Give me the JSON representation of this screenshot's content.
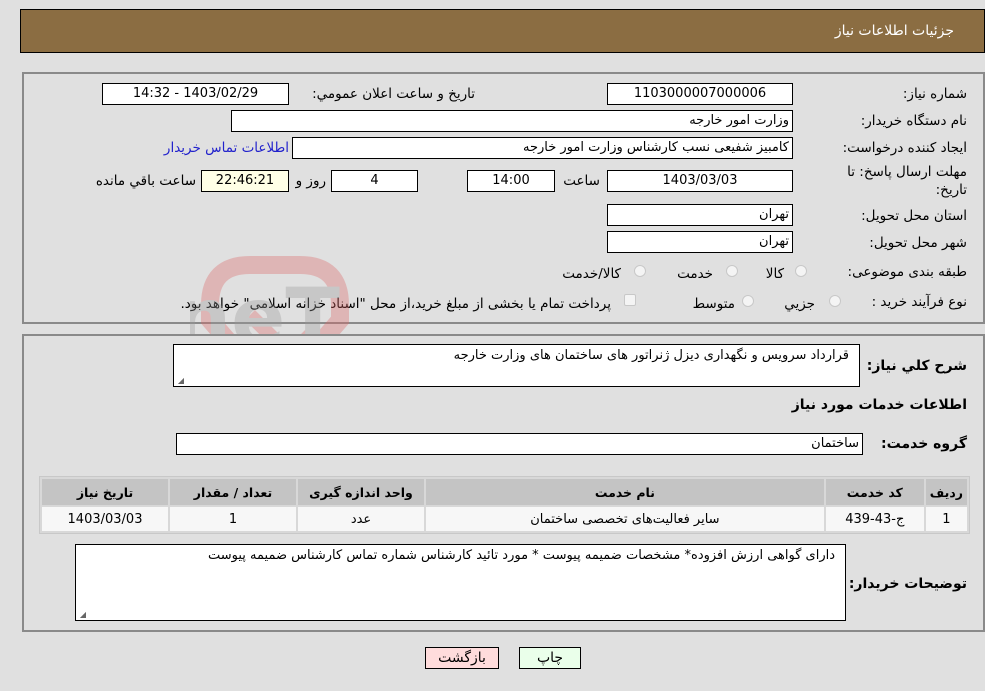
{
  "header": {
    "title": "جزئیات اطلاعات نیاز"
  },
  "form": {
    "need_number_label": "شماره نیاز:",
    "need_number": "1103000007000006",
    "announce_label": "تاریخ و ساعت اعلان عمومي:",
    "announce_value": "1403/02/29 - 14:32",
    "buyer_org_label": "نام دستگاه خریدار:",
    "buyer_org": "وزارت امور خارجه",
    "creator_label": "ایجاد کننده درخواست:",
    "creator": "کامبیز شفیعی نسب کارشناس وزارت امور خارجه",
    "buyer_contact_link": "اطلاعات تماس خریدار",
    "deadline_label_line1": "مهلت ارسال پاسخ: تا",
    "deadline_label_line2": "تاریخ:",
    "deadline_date": "1403/03/03",
    "time_label": "ساعت",
    "deadline_time": "14:00",
    "days_value": "4",
    "days_label": "روز و",
    "remaining_time": "22:46:21",
    "remaining_label": "ساعت باقي مانده",
    "province_label": "استان محل تحویل:",
    "province": "تهران",
    "city_label": "شهر محل تحویل:",
    "city": "تهران",
    "category_label": "طبقه بندی موضوعی:",
    "category_options": [
      "کالا",
      "خدمت",
      "کالا/خدمت"
    ],
    "process_label": "نوع فرآیند خرید :",
    "process_options": [
      "جزيي",
      "متوسط"
    ],
    "treasury_note": "پرداخت تمام یا بخشی از مبلغ خرید،از محل \"اسناد خزانه اسلامی\" خواهد بود."
  },
  "details": {
    "summary_label": "شرح کلي نیاز:",
    "summary": "قرارداد سرویس و نگهداری دیزل ژنراتور های  ساختمان های وزارت خارجه",
    "services_heading": "اطلاعات خدمات مورد نیاز",
    "service_group_label": "گروه خدمت:",
    "service_group": "ساختمان",
    "table": {
      "headers": [
        "ردیف",
        "کد خدمت",
        "نام خدمت",
        "واحد اندازه گیری",
        "تعداد / مقدار",
        "تاریخ نیاز"
      ],
      "rows": [
        [
          "1",
          "ج-43-439",
          "سایر فعالیت‌های تخصصی ساختمان",
          "عدد",
          "1",
          "1403/03/03"
        ]
      ]
    },
    "buyer_notes_label": "توضیحات خریدار:",
    "buyer_notes": "دارای گواهی ارزش افزوده* مشخصات ضمیمه پیوست * مورد تائید کارشناس شماره  تماس کارشناس  ضمیمه پیوست"
  },
  "buttons": {
    "print": "چاپ",
    "back": "بازگشت"
  },
  "watermark": {
    "text": "AriaTender.neT"
  },
  "colors": {
    "header_bg": "#8b6d42",
    "print_bg": "#eaffea",
    "back_bg": "#ffdcdc",
    "link": "#2222cc"
  }
}
